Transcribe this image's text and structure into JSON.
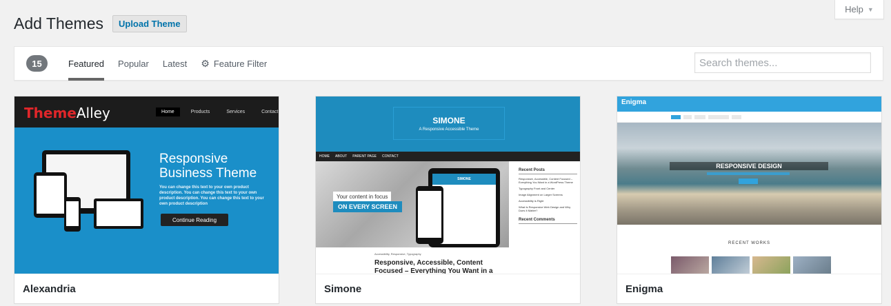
{
  "help": {
    "label": "Help",
    "caret": "▼"
  },
  "header": {
    "title": "Add Themes",
    "upload_label": "Upload Theme"
  },
  "filter": {
    "count": "15",
    "tabs": [
      {
        "label": "Featured",
        "active": true
      },
      {
        "label": "Popular",
        "active": false
      },
      {
        "label": "Latest",
        "active": false
      },
      {
        "label": "Feature Filter",
        "icon": "gear-icon",
        "active": false
      }
    ],
    "search_placeholder": "Search themes..."
  },
  "themes": [
    {
      "name": "Alexandria",
      "preview": {
        "logo_red": "Theme",
        "logo_white": "Alley",
        "nav": [
          "Home",
          "Products",
          "Services",
          "Contact"
        ],
        "hero_title_1": "Responsive",
        "hero_title_2": "Business Theme",
        "hero_text": "You can change this text to your own product description. You can change this text to your own product description. You can change this text to your own product description",
        "button": "Continue Reading"
      }
    },
    {
      "name": "Simone",
      "preview": {
        "site_title": "SIMONE",
        "tagline": "A Responsive Accessible Theme",
        "menu": [
          "HOME",
          "ABOUT",
          "PARENT PAGE",
          "CONTACT"
        ],
        "focus_text": "Your content in focus",
        "every_screen": "ON EVERY SCREEN",
        "tablet_title": "SIMONE",
        "sidebar_title": "Recent Posts",
        "recent_posts": [
          "Responsive, Accessible, Content Focused – Everything You Want in a WordPress Theme",
          "Typography Front and Center",
          "Image Alignment on Larger Screens",
          "Accessibility is Right",
          "What Is Responsive Web Design and Why Does It Matter?"
        ],
        "comments_title": "Recent Comments",
        "tags": "Accessibility, Responsive, Typography",
        "post_title": "Responsive, Accessible, Content Focused – Everything You Want in a"
      }
    },
    {
      "name": "Enigma",
      "preview": {
        "site_title": "Enigma",
        "banner": "RESPONSIVE DESIGN",
        "works": "RECENT WORKS"
      }
    }
  ]
}
